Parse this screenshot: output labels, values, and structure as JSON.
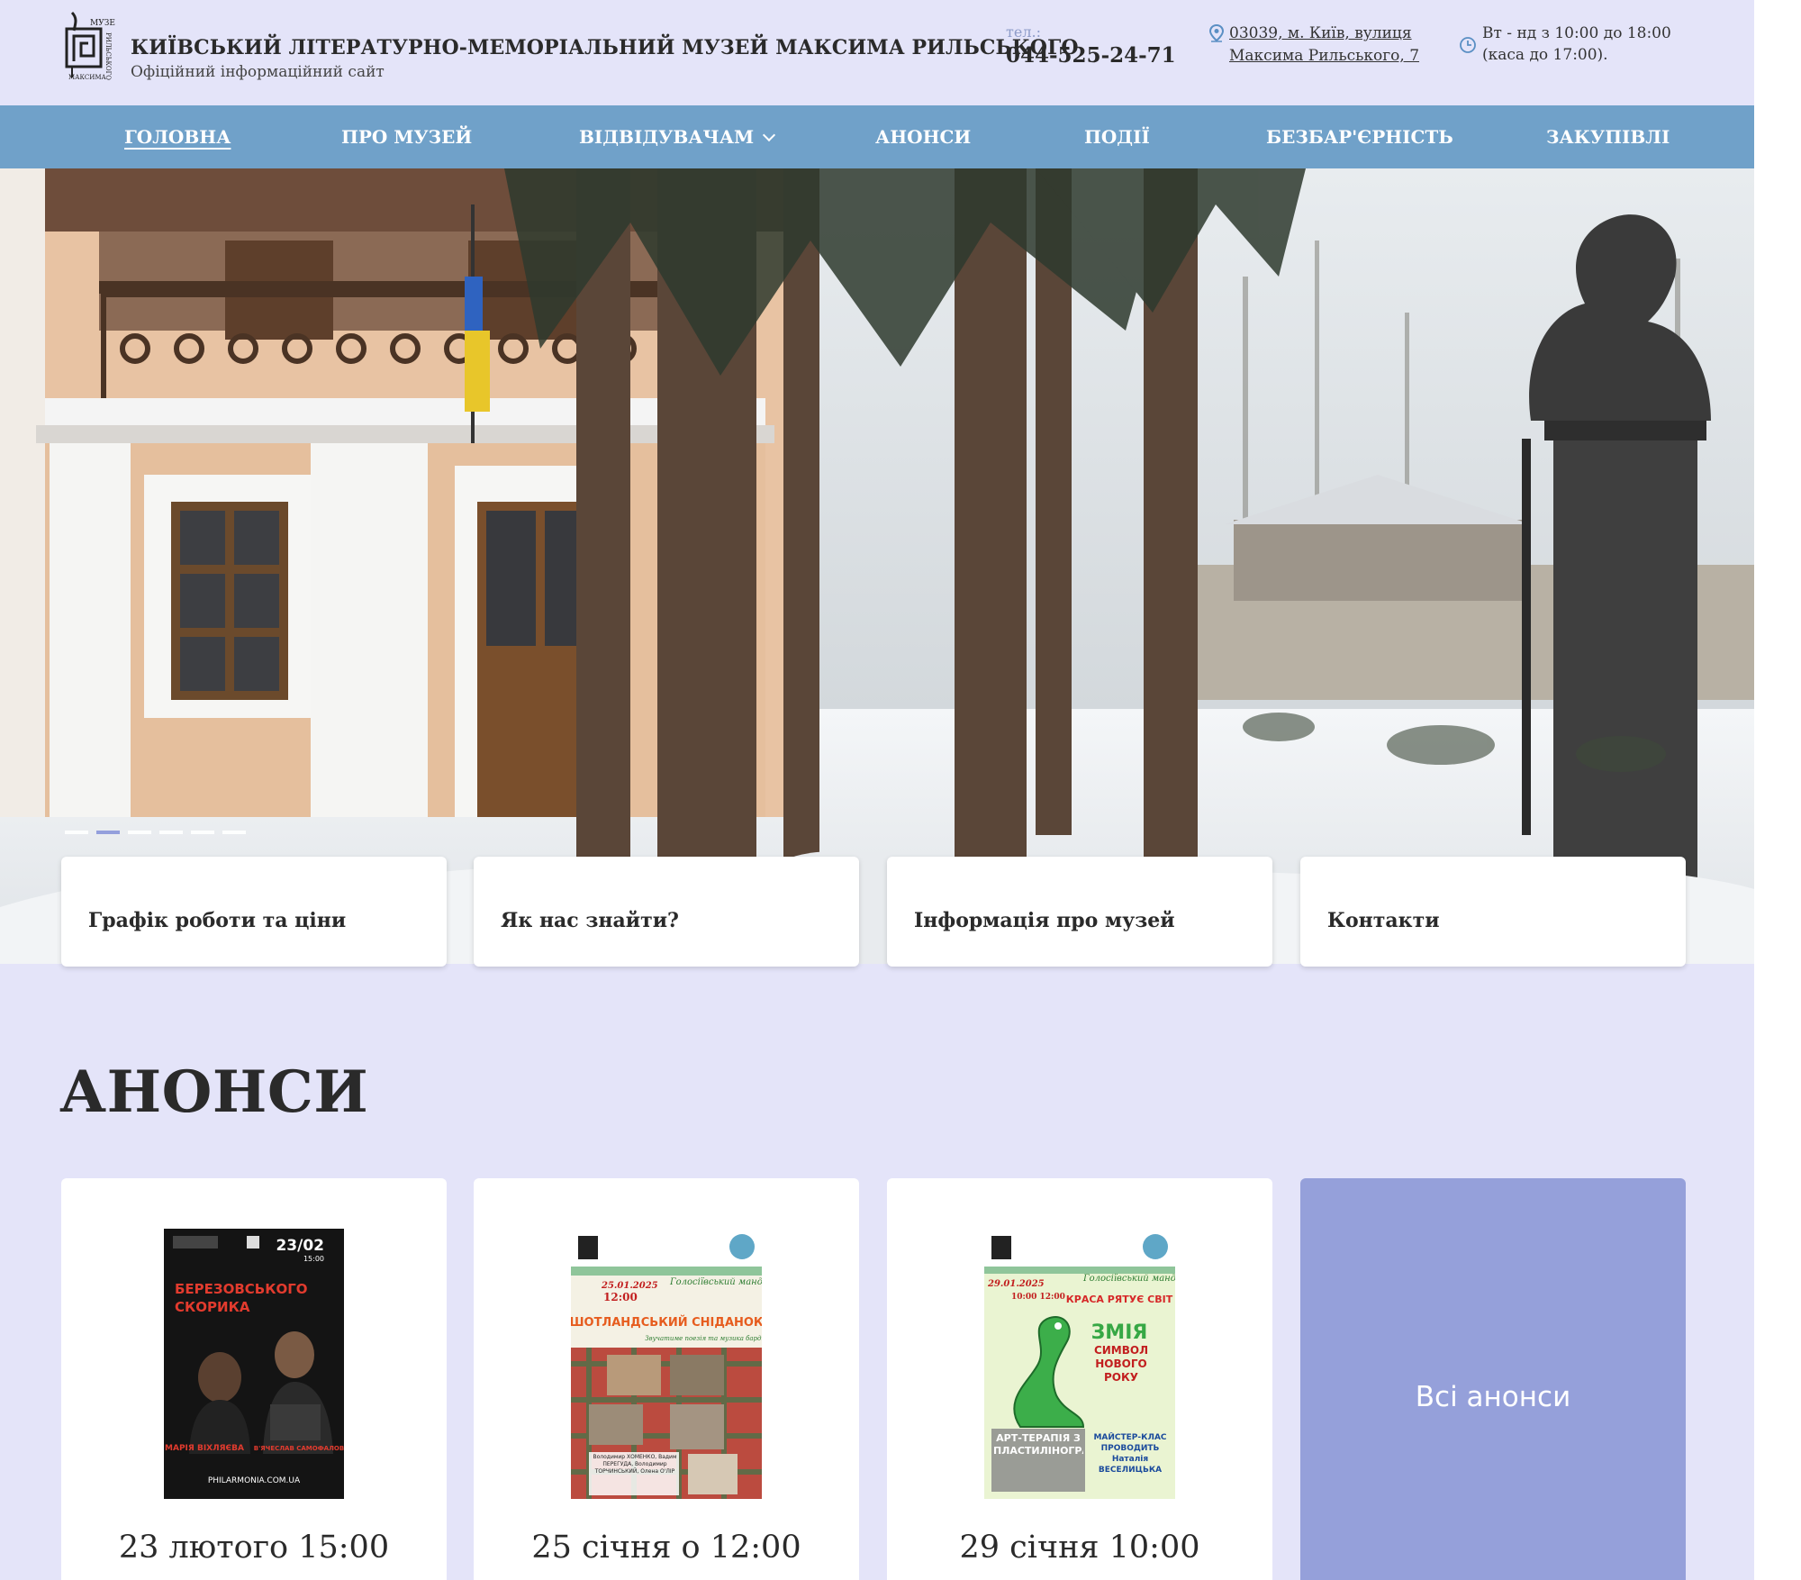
{
  "header": {
    "title": "КИЇВСЬКИЙ ЛІТЕРАТУРНО-МЕМОРІАЛЬНИЙ МУЗЕЙ МАКСИМА РИЛЬСЬКОГО",
    "subtitle": "Офіційний інформаційний сайт",
    "logo_text": "МУЗЕЙ МАКСИМА РИЛЬСЬКОГО",
    "tel_label": "тел.:",
    "tel": "044-525-24-71",
    "address_line1": "03039, м. Київ, вулиця",
    "address_line2": "Максима Рильського, 7",
    "hours_line1": "Вт - нд з 10:00 до 18:00",
    "hours_line2": "(каса до 17:00)."
  },
  "nav": {
    "items": [
      {
        "label": "ГОЛОВНА",
        "active": true
      },
      {
        "label": "ПРО МУЗЕЙ"
      },
      {
        "label": "ВІДВІДУВАЧАМ",
        "dropdown": true
      },
      {
        "label": "АНОНСИ"
      },
      {
        "label": "ПОДІЇ"
      },
      {
        "label": "БЕЗБАР'ЄРНІСТЬ"
      },
      {
        "label": "ЗАКУПІВЛІ"
      }
    ]
  },
  "hero": {
    "slide_count": 6,
    "active_slide": 2
  },
  "quick_links": [
    {
      "label": "Графік роботи та ціни"
    },
    {
      "label": "Як нас знайти?"
    },
    {
      "label": "Інформація про музей"
    },
    {
      "label": "Контакти"
    }
  ],
  "announcements": {
    "title": "АНОНСИ",
    "cards": [
      {
        "date": "23 лютого 15:00",
        "poster": {
          "date": "23/02",
          "time": "15:00",
          "name1": "БЕРЕЗОВСЬКОГО",
          "name2": "СКОРИКА",
          "person1": "МАРІЯ ВІХЛЯЄВА",
          "person2": "В'ЯЧЕСЛАВ САМОФАЛОВ",
          "site": "PHILARMONIA.COM.UA"
        }
      },
      {
        "date": "25 січня о 12:00",
        "poster": {
          "date": "25.01.2025",
          "time": "12:00",
          "header": "Голосіївський мандат",
          "title": "ШОТЛАНДСЬКИЙ СНІДАНОК",
          "sub": "Звучатиме поезія та музика бардів",
          "names": "Володимир ХОМЕНКО, Вадим ПЕРЕГУДА, Володимир ТОРЧИНСЬКИЙ, Олена О'ЛІР"
        }
      },
      {
        "date": "29 січня 10:00",
        "poster": {
          "date": "29.01.2025",
          "time": "10:00 12:00",
          "header": "Голосіївський мандат",
          "line1": "КРАСА РЯТУЄ СВІТ",
          "line2": "ЗМІЯ",
          "line3": "СИМВОЛ НОВОГО РОКУ",
          "line4": "АРТ-ТЕРАПІЯ З ПЛАСТИЛІНОГРАФІЇ",
          "line5": "МАЙСТЕР-КЛАС ПРОВОДИТЬ Наталія ВЕСЕЛИЦЬКА"
        }
      }
    ],
    "all_label": "Всі анонси"
  },
  "colors": {
    "page_bg": "#e4e4f9",
    "nav_bg": "#70a1c9",
    "all_card_bg": "#95a0da",
    "slider_active": "#8b96d9"
  }
}
